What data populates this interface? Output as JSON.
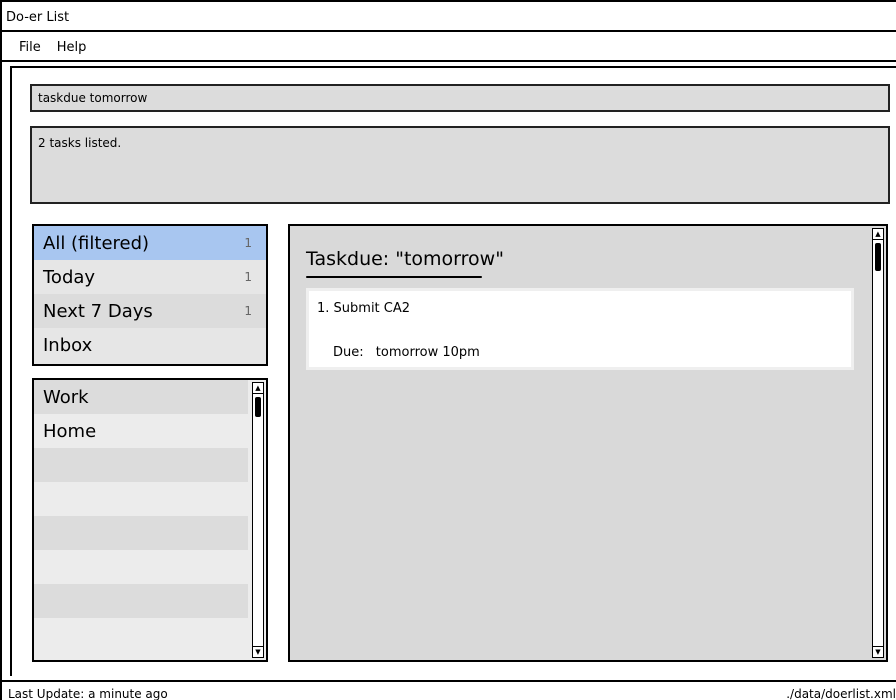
{
  "window": {
    "title": "Do-er List"
  },
  "menu": {
    "items": [
      "File",
      "Help"
    ]
  },
  "command": {
    "value": "taskdue tomorrow"
  },
  "result": {
    "text": "2 tasks listed."
  },
  "filters": [
    {
      "label": "All (filtered)",
      "count": "1",
      "selected": true
    },
    {
      "label": "Today",
      "count": "1",
      "selected": false
    },
    {
      "label": "Next 7 Days",
      "count": "1",
      "selected": false
    },
    {
      "label": "Inbox",
      "count": "",
      "selected": false
    }
  ],
  "categories": {
    "items": [
      "Work",
      "Home"
    ]
  },
  "detail": {
    "title": "Taskdue: \"tomorrow\"",
    "tasks": [
      {
        "name": "1. Submit CA2",
        "due_label": "Due:",
        "due_value": "tomorrow 10pm"
      }
    ]
  },
  "status": {
    "last_update": "Last Update: a minute ago",
    "file_path": "./data/doerlist.xml"
  },
  "colors": {
    "selected": "#a8c6f0",
    "panel": "#dcdcdc"
  },
  "icons": {
    "scroll_up": "scroll-up-arrow-icon",
    "scroll_down": "scroll-down-arrow-icon"
  }
}
